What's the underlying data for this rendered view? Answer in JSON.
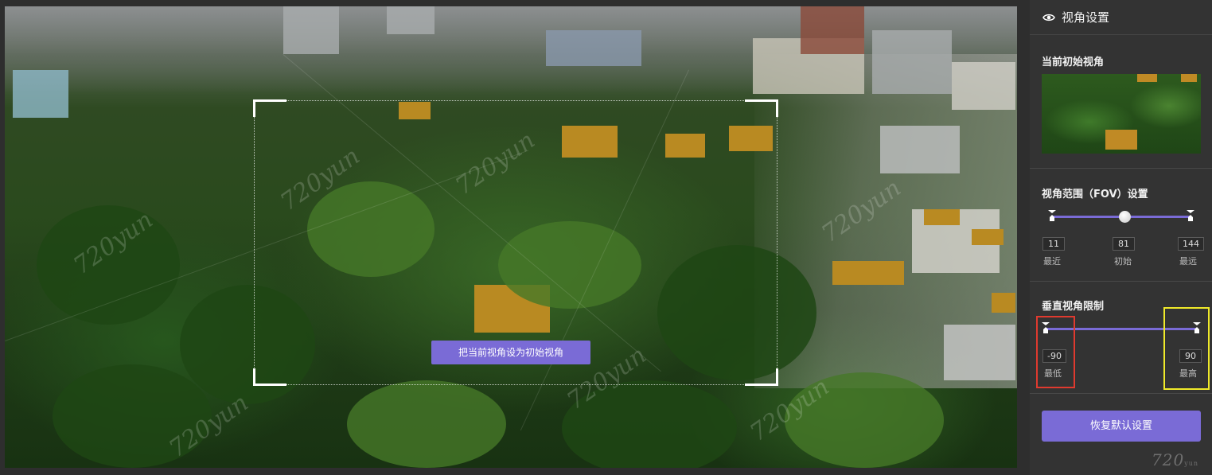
{
  "viewer": {
    "set_initial_button": "把当前视角设为初始视角",
    "watermark": "720yun"
  },
  "panel": {
    "title": "视角设置",
    "title_icon": "eye-icon",
    "initial_view": {
      "title": "当前初始视角"
    },
    "fov": {
      "title": "视角范围（FOV）设置",
      "min": {
        "value": "11",
        "label": "最近"
      },
      "init": {
        "value": "81",
        "label": "初始"
      },
      "max": {
        "value": "144",
        "label": "最远"
      }
    },
    "vertical": {
      "title": "垂直视角限制",
      "low": {
        "value": "-90",
        "label": "最低"
      },
      "high": {
        "value": "90",
        "label": "最高"
      }
    },
    "reset_button": "恢复默认设置"
  },
  "logo": {
    "text": "720",
    "sub": "yun"
  },
  "colors": {
    "accent": "#7a6bd6",
    "highlight_red": "#e03a2f",
    "highlight_yellow": "#f0ea2a"
  }
}
